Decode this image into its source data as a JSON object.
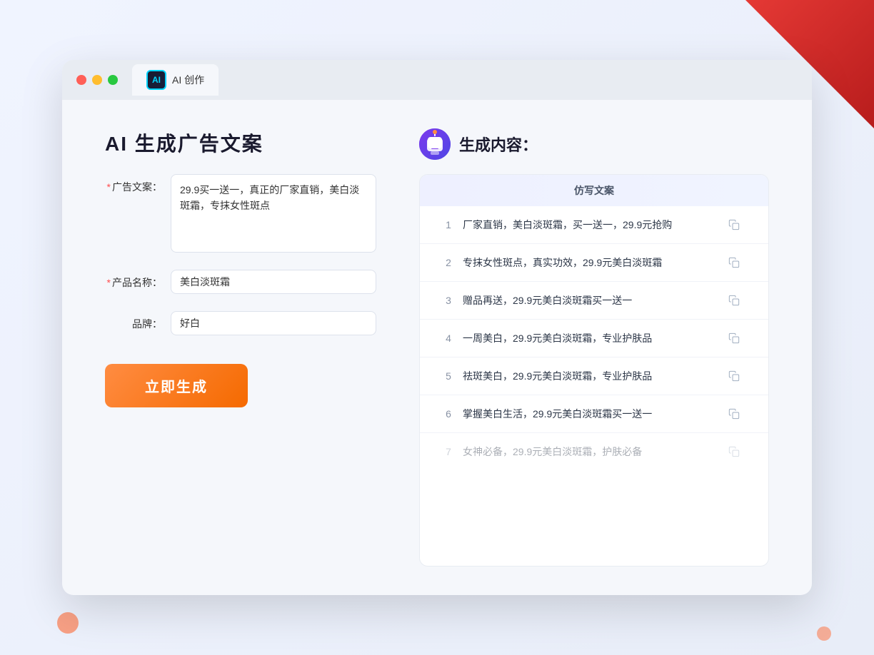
{
  "window": {
    "tab_label": "AI 创作",
    "ai_icon_text": "AI"
  },
  "page": {
    "title": "AI 生成广告文案",
    "generate_button_label": "立即生成"
  },
  "form": {
    "ad_copy_label": "广告文案：",
    "ad_copy_required": "*",
    "ad_copy_value": "29.9买一送一，真正的厂家直销，美白淡斑霜，专抹女性斑点",
    "product_name_label": "产品名称：",
    "product_name_required": "*",
    "product_name_value": "美白淡斑霜",
    "brand_label": "品牌：",
    "brand_value": "好白"
  },
  "results": {
    "section_title": "生成内容：",
    "column_header": "仿写文案",
    "items": [
      {
        "num": "1",
        "text": "厂家直销，美白淡斑霜，买一送一，29.9元抢购",
        "dimmed": false
      },
      {
        "num": "2",
        "text": "专抹女性斑点，真实功效，29.9元美白淡斑霜",
        "dimmed": false
      },
      {
        "num": "3",
        "text": "赠品再送，29.9元美白淡斑霜买一送一",
        "dimmed": false
      },
      {
        "num": "4",
        "text": "一周美白，29.9元美白淡斑霜，专业护肤品",
        "dimmed": false
      },
      {
        "num": "5",
        "text": "祛斑美白，29.9元美白淡斑霜，专业护肤品",
        "dimmed": false
      },
      {
        "num": "6",
        "text": "掌握美白生活，29.9元美白淡斑霜买一送一",
        "dimmed": false
      },
      {
        "num": "7",
        "text": "女神必备，29.9元美白淡斑霜，护肤必备",
        "dimmed": true
      }
    ]
  }
}
